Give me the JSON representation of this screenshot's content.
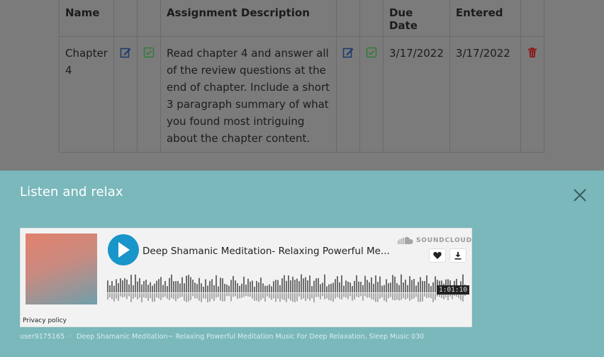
{
  "table": {
    "headers": {
      "name": "Name",
      "description": "Assignment Description",
      "due_date": "Due Date",
      "entered": "Entered"
    },
    "row": {
      "name": "Chapter 4",
      "description": "Read chapter 4 and answer all of the review questions at the end of chapter. Include a short 3 paragraph summary of what you found most intriguing about the chapter content.",
      "due_date": "3/17/2022",
      "entered": "3/17/2022"
    },
    "icons": [
      "edit-icon",
      "check-square-icon",
      "trash-icon"
    ]
  },
  "panel": {
    "title": "Listen and relax",
    "close_icon": "close-icon"
  },
  "player": {
    "track_title": "Deep Shamanic Meditation- Relaxing Powerful Me...",
    "brand": "SOUNDCLOUD",
    "duration": "1:01:10",
    "privacy": "Privacy policy",
    "like_icon": "heart-icon",
    "download_icon": "download-icon",
    "play_icon": "play-icon"
  },
  "footer": {
    "user": "user9175165",
    "separator": "·",
    "track_full": "Deep Shamanic Meditation~ Relaxing Powerful Meditation Music For Deep Relaxation, Sleep Music 030"
  },
  "colors": {
    "overlay": "#7b7b7b",
    "panel": "#7ab8bb",
    "play": "#1895c9"
  }
}
